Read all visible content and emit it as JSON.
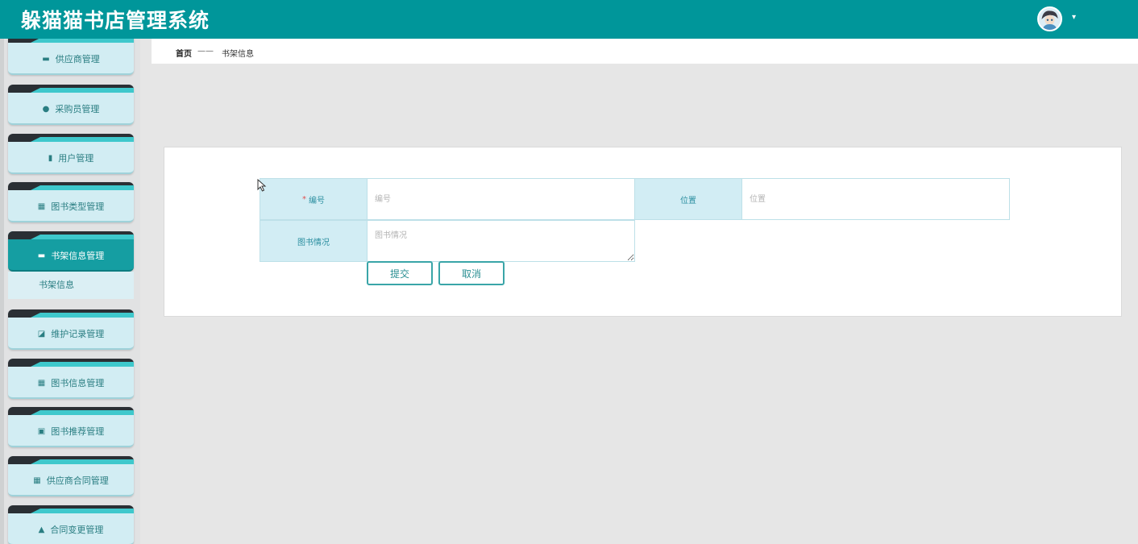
{
  "header": {
    "title": "躲猫猫书店管理系统",
    "user_menu_caret": "▾"
  },
  "sidebar": {
    "items": [
      {
        "label": "供应商管理",
        "icon": "chat-icon"
      },
      {
        "label": "采购员管理",
        "icon": "user-icon"
      },
      {
        "label": "用户管理",
        "icon": "clipboard-icon"
      },
      {
        "label": "图书类型管理",
        "icon": "grid-icon"
      },
      {
        "label": "书架信息管理",
        "icon": "ticket-icon",
        "active": true
      },
      {
        "label": "维护记录管理",
        "icon": "chart-icon"
      },
      {
        "label": "图书信息管理",
        "icon": "grid-icon"
      },
      {
        "label": "图书推荐管理",
        "icon": "clipboard-check-icon"
      },
      {
        "label": "供应商合同管理",
        "icon": "grid-icon"
      },
      {
        "label": "合同变更管理",
        "icon": "thumbs-up-icon"
      }
    ],
    "submenu": {
      "label": "书架信息"
    }
  },
  "breadcrumb": {
    "home": "首页",
    "separator": "——",
    "current": "书架信息"
  },
  "form": {
    "fields": {
      "number": {
        "label": "编号",
        "required_mark": "*",
        "placeholder": "编号",
        "value": ""
      },
      "location": {
        "label": "位置",
        "placeholder": "位置",
        "value": ""
      },
      "book_status": {
        "label": "图书情况",
        "placeholder": "图书情况",
        "value": ""
      }
    },
    "submit_label": "提交",
    "cancel_label": "取消"
  },
  "colors": {
    "header_bg": "#00969a",
    "active_menu": "#159ea2",
    "label_cell_bg": "#d2edf4",
    "button_border": "#3aa5a8"
  }
}
